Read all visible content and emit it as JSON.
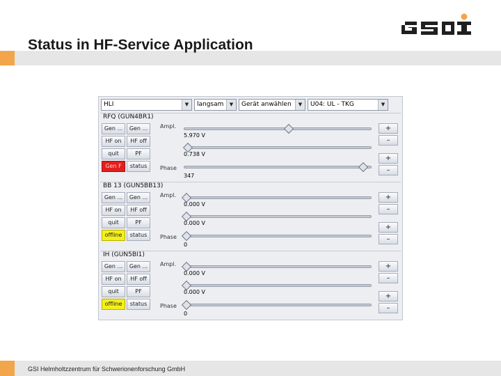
{
  "slide": {
    "title": "Status in HF-Service Application",
    "footer": "GSI Helmholtzzentrum für Schwerionenforschung GmbH",
    "logo_text": "GSI",
    "logo_color": "#1f1f1f",
    "accent_color": "#f2a54a",
    "band_color": "#e6e6e6"
  },
  "app": {
    "dropdowns": [
      {
        "value": "HLI",
        "arrow": "▼"
      },
      {
        "value": "langsam",
        "arrow": "▼"
      },
      {
        "value": "Gerät anwählen",
        "arrow": "▼"
      },
      {
        "value": "U04: UL  - TKG",
        "arrow": "▼"
      }
    ],
    "ampl_label": "Ampl.",
    "phase_label": "Phase",
    "plus": "+",
    "minus": "–",
    "sections": [
      {
        "title": "RFQ (GUN4BR1)",
        "buttons": [
          [
            "Gen ...",
            "Gen ..."
          ],
          [
            "HF on",
            "HF off"
          ],
          [
            "quit",
            "PF"
          ],
          [
            "Gen F",
            "status"
          ]
        ],
        "status_color": "red",
        "ampl_value": "5.970 V",
        "ampl_pos": 0.56,
        "ampl2_value": "0.738 V",
        "ampl2_pos": 0.02,
        "phase_value": "347",
        "phase_pos": 0.96
      },
      {
        "title": "BB 13 (GUN5BB13)",
        "buttons": [
          [
            "Gen ...",
            "Gen ..."
          ],
          [
            "HF on",
            "HF off"
          ],
          [
            "quit",
            "PF"
          ],
          [
            "offline",
            "status"
          ]
        ],
        "status_color": "yellow",
        "ampl_value": "0.000 V",
        "ampl_pos": 0.01,
        "ampl2_value": "0.000 V",
        "ampl2_pos": 0.01,
        "phase_value": "0",
        "phase_pos": 0.01
      },
      {
        "title": "IH (GUN5BI1)",
        "buttons": [
          [
            "Gen ...",
            "Gen ..."
          ],
          [
            "HF on",
            "HF off"
          ],
          [
            "quit",
            "PF"
          ],
          [
            "offline",
            "status"
          ]
        ],
        "status_color": "yellow",
        "ampl_value": "0.000 V",
        "ampl_pos": 0.01,
        "ampl2_value": "0.000 V",
        "ampl2_pos": 0.01,
        "phase_value": "0",
        "phase_pos": 0.01
      }
    ]
  }
}
